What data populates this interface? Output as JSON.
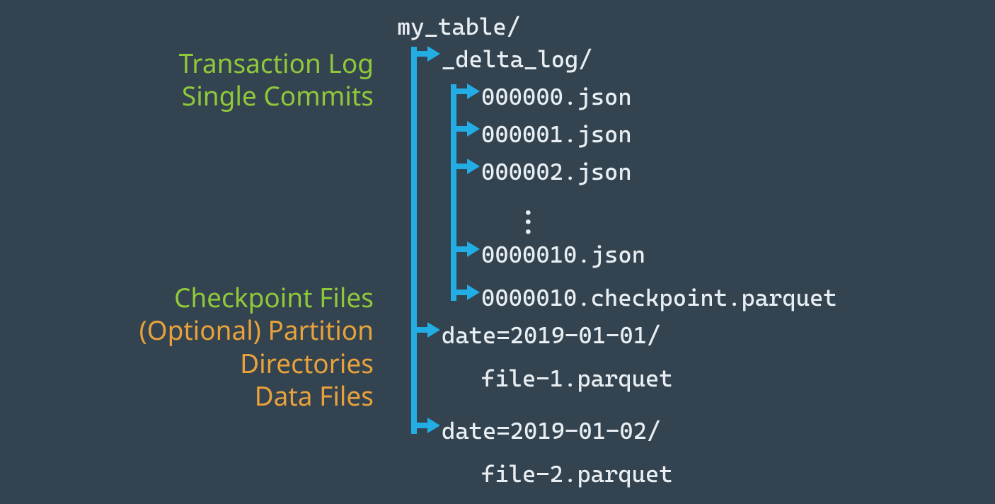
{
  "colors": {
    "background": "#334350",
    "arrow": "#22aee5",
    "text": "#e8eef2",
    "green": "#8fc93a",
    "orange": "#e9a23b"
  },
  "labels": {
    "transaction_log": "Transaction Log",
    "single_commits": "Single Commits",
    "checkpoint_files": "Checkpoint Files",
    "partition_dirs": "(Optional) Partition Directories",
    "data_files": "Data Files"
  },
  "fs": {
    "root": "my_table/",
    "delta_log_dir": "_delta_log/",
    "commits": [
      "000000.json",
      "000001.json",
      "000002.json",
      "0000010.json"
    ],
    "checkpoint": "0000010.checkpoint.parquet",
    "partitions": [
      {
        "dir": "date=2019-01-01/",
        "files": [
          "file-1.parquet"
        ]
      },
      {
        "dir": "date=2019-01-02/",
        "files": [
          "file-2.parquet"
        ]
      }
    ]
  }
}
